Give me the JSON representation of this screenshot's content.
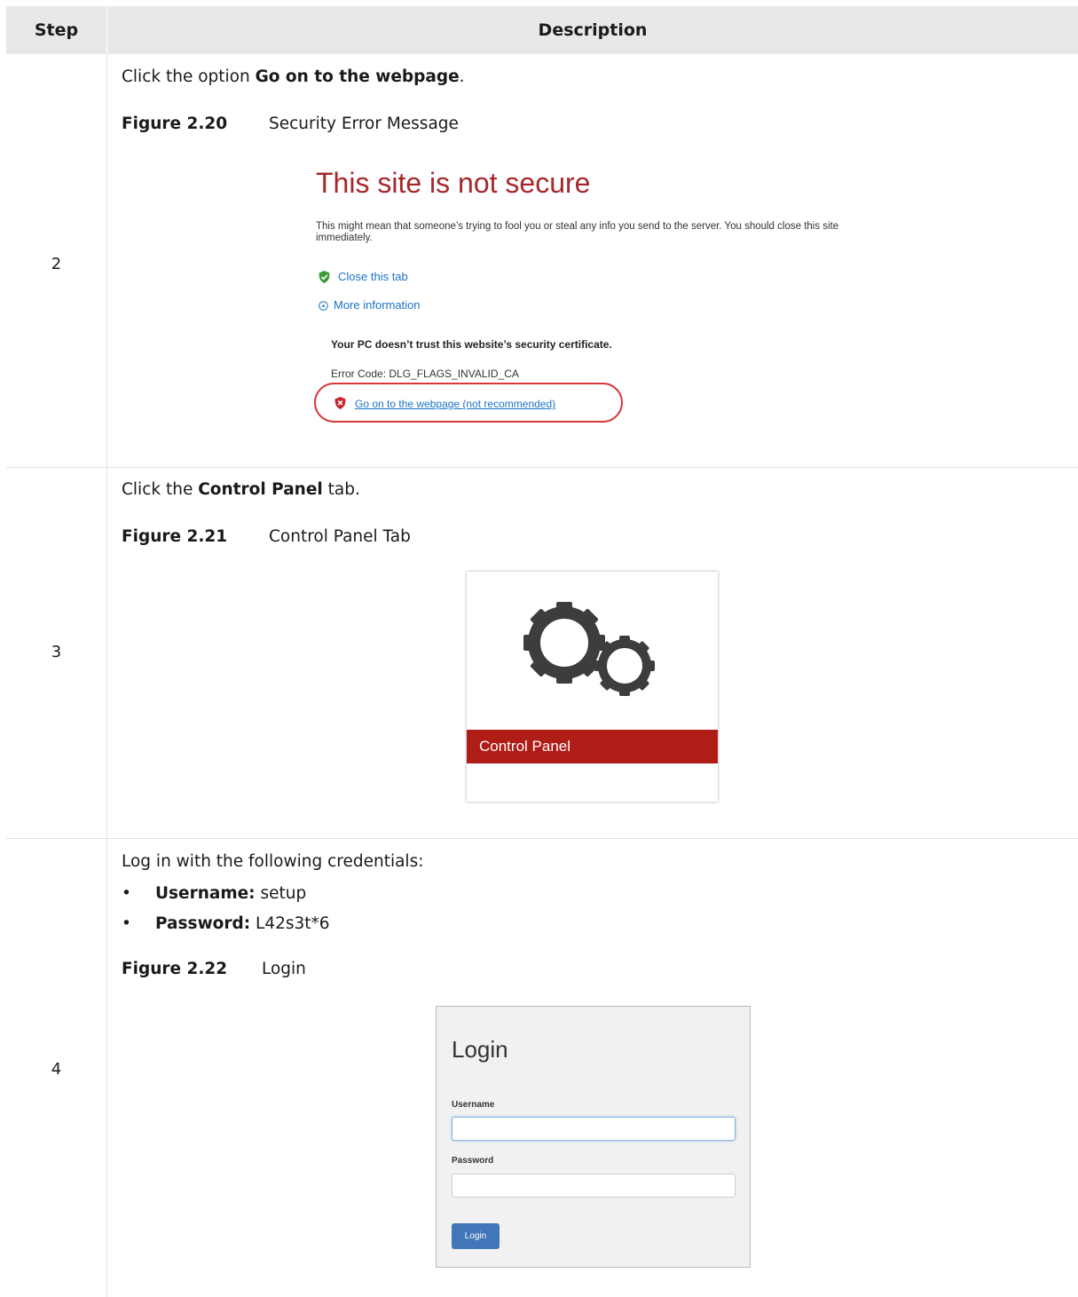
{
  "table": {
    "header": {
      "step": "Step",
      "description": "Description"
    },
    "rows": [
      {
        "step": "2",
        "instruction_pre": "Click the option ",
        "instruction_bold": "Go on to the webpage",
        "instruction_post": ".",
        "figure_number": "Figure 2.20",
        "figure_title": "Security Error Message",
        "figure": {
          "title": "This site is not secure",
          "body": "This might mean that someone’s trying to fool you or steal any info you send to the server. You should close this site immediately.",
          "close_link": "Close this tab",
          "more_info": "More information",
          "trust_msg": "Your PC doesn’t trust this website’s security certificate.",
          "error_code": "Error Code: DLG_FLAGS_INVALID_CA",
          "go_link": "Go on to the webpage (not recommended)"
        }
      },
      {
        "step": "3",
        "instruction_pre": "Click the ",
        "instruction_bold": "Control Panel",
        "instruction_post": " tab.",
        "figure_number": "Figure 2.21",
        "figure_title": "Control Panel Tab",
        "figure": {
          "tile_label": "Control Panel",
          "icon": "gears-icon"
        }
      },
      {
        "step": "4",
        "instruction": "Log in with the following credentials:",
        "bullets": [
          {
            "label": "Username:",
            "value": " setup"
          },
          {
            "label": "Password:",
            "value": " L42s3t*6"
          }
        ],
        "figure_number": "Figure 2.22",
        "figure_title": "Login",
        "figure": {
          "title": "Login",
          "username_label": "Username",
          "password_label": "Password",
          "button": "Login"
        }
      }
    ]
  },
  "colors": {
    "header_bg": "#e8e8e8",
    "alert_red": "#a6282c",
    "link_blue": "#1c73c6",
    "tile_red": "#b01c16",
    "button_blue": "#4176b8"
  }
}
